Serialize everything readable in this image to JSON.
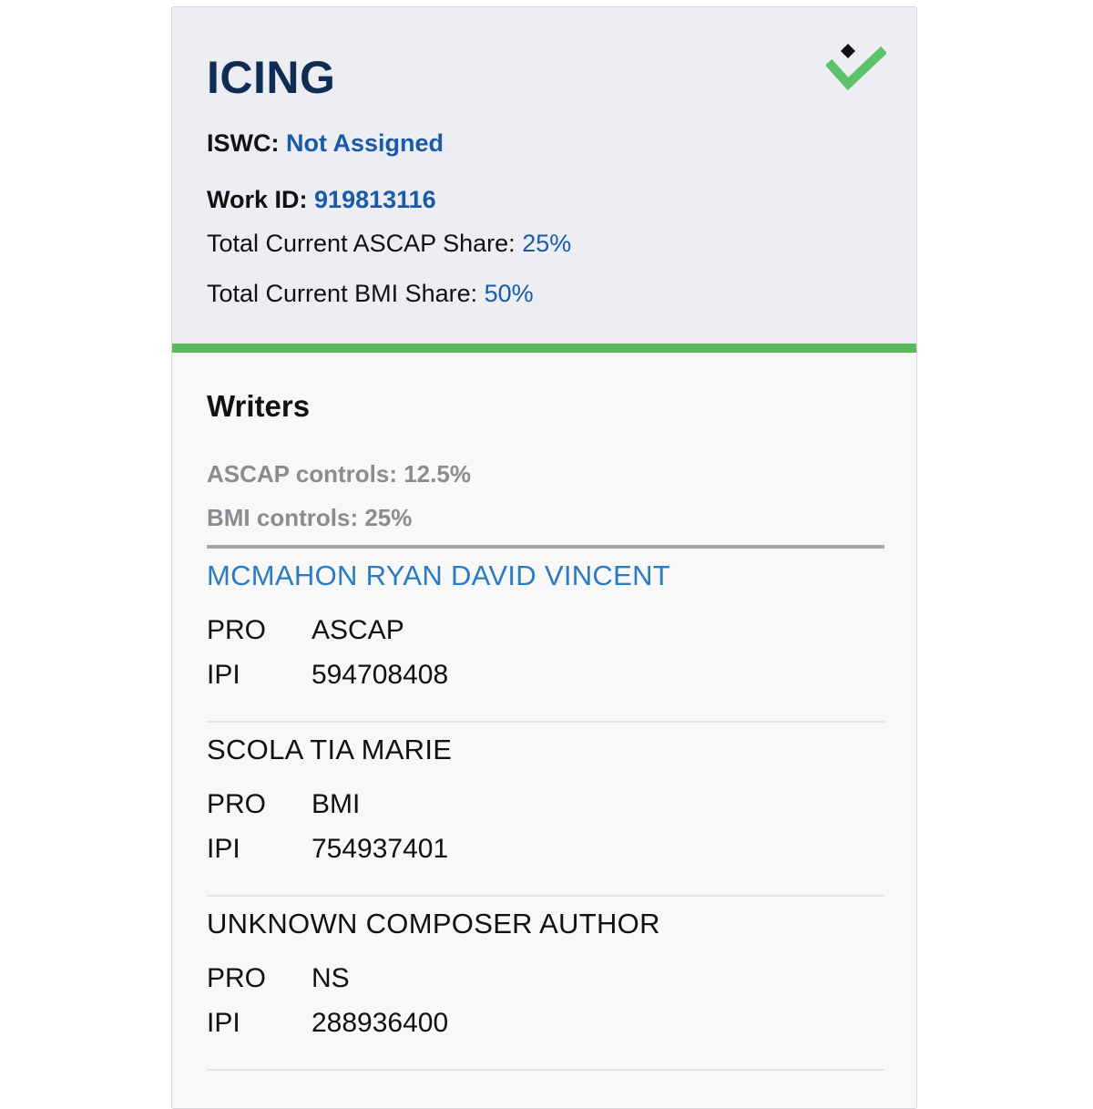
{
  "work": {
    "title": "ICING",
    "iswc_label": "ISWC:",
    "iswc_value": "Not Assigned",
    "work_id_label": "Work ID:",
    "work_id_value": "919813116",
    "ascap_share_label": "Total Current ASCAP Share:",
    "ascap_share_value": "25%",
    "bmi_share_label": "Total Current BMI Share:",
    "bmi_share_value": "50%",
    "status_icon": "green-checkmark-diamond-icon"
  },
  "writers": {
    "heading": "Writers",
    "ascap_controls": "ASCAP controls: 12.5%",
    "bmi_controls": "BMI controls: 25%",
    "pro_label": "PRO",
    "ipi_label": "IPI",
    "items": [
      {
        "name": "MCMAHON RYAN DAVID VINCENT",
        "pro": "ASCAP",
        "ipi": "594708408"
      },
      {
        "name": "SCOLA TIA MARIE",
        "pro": "BMI",
        "ipi": "754937401"
      },
      {
        "name": "UNKNOWN COMPOSER AUTHOR",
        "pro": "NS",
        "ipi": "288936400"
      }
    ]
  },
  "colors": {
    "title": "#0f2c52",
    "link": "#2a7bc4",
    "value": "#1a5aa8",
    "accent": "#5cb85c",
    "muted": "#8c8c90"
  }
}
